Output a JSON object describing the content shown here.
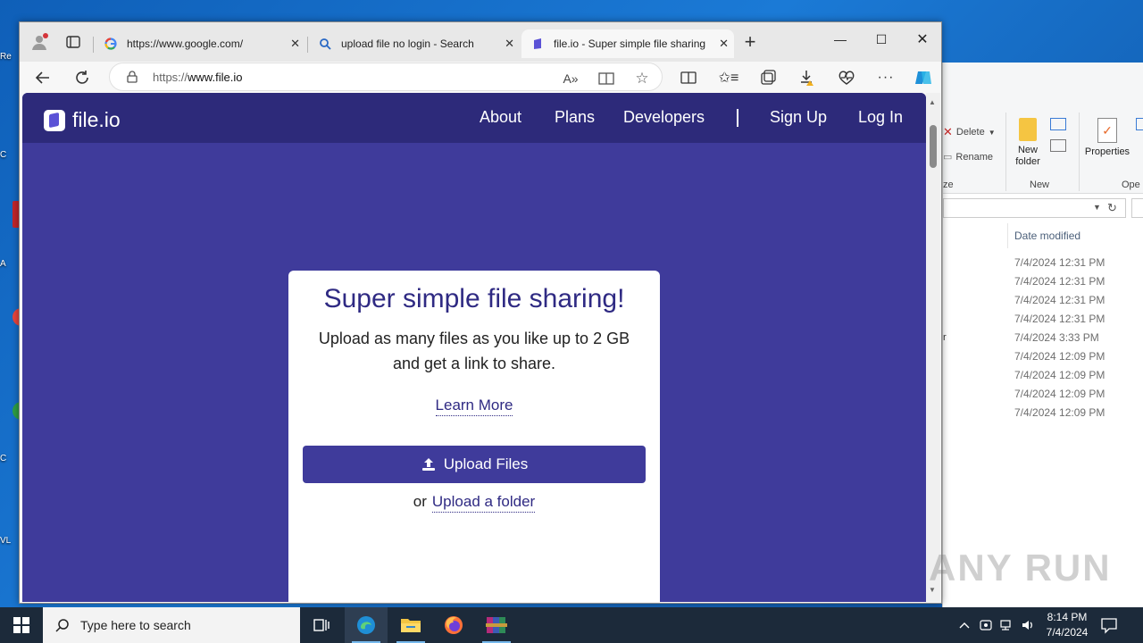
{
  "desktop": {
    "fragments": [
      "Re",
      "C",
      "A",
      "C",
      "VL"
    ]
  },
  "explorer": {
    "ribbon": {
      "delete": "Delete",
      "rename": "Rename",
      "new_folder": "New folder",
      "properties": "Properties",
      "group_new": "New",
      "group_open": "Ope",
      "group_organize": "ze"
    },
    "column_header": "Date modified",
    "dates": [
      "7/4/2024 12:31 PM",
      "7/4/2024 12:31 PM",
      "7/4/2024 12:31 PM",
      "7/4/2024 12:31 PM",
      "7/4/2024 3:33 PM",
      "7/4/2024 12:09 PM",
      "7/4/2024 12:09 PM",
      "7/4/2024 12:09 PM",
      "7/4/2024 12:09 PM"
    ],
    "name_fragment": "r"
  },
  "browser": {
    "tabs": [
      {
        "label": "https://www.google.com/",
        "icon": "google-icon"
      },
      {
        "label": "upload file no login - Search",
        "icon": "search-icon"
      },
      {
        "label": "file.io - Super simple file sharing",
        "icon": "fileio-icon"
      }
    ],
    "address": {
      "protocol": "https://",
      "host": "www.file.io"
    }
  },
  "site": {
    "logo": "file.io",
    "nav": {
      "about": "About",
      "plans": "Plans",
      "developers": "Developers",
      "signup": "Sign Up",
      "login": "Log In"
    },
    "card": {
      "title": "Super simple file sharing!",
      "subtitle": "Upload as many files as you like up to 2 GB and get a link to share.",
      "learn_more": "Learn More",
      "upload_button": "Upload Files",
      "or": "or",
      "upload_folder": "Upload a folder"
    }
  },
  "watermark": "ANY RUN",
  "taskbar": {
    "search_placeholder": "Type here to search",
    "time": "8:14 PM",
    "date": "7/4/2024"
  },
  "colors": {
    "brand_purple": "#3f3b9b",
    "header_purple": "#2d2a7a",
    "title_purple": "#2f2a83"
  }
}
